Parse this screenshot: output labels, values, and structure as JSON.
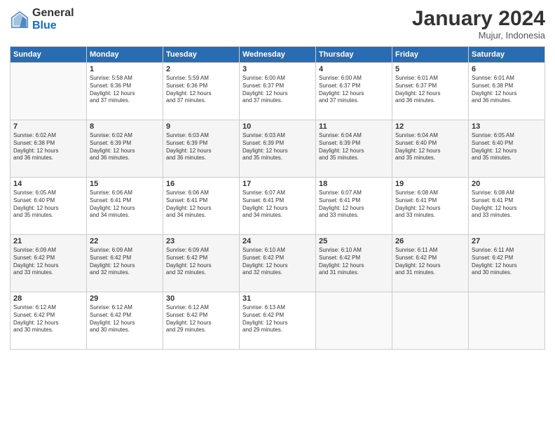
{
  "logo": {
    "general": "General",
    "blue": "Blue"
  },
  "title": "January 2024",
  "subtitle": "Mujur, Indonesia",
  "days_header": [
    "Sunday",
    "Monday",
    "Tuesday",
    "Wednesday",
    "Thursday",
    "Friday",
    "Saturday"
  ],
  "weeks": [
    [
      {
        "day": "",
        "info": ""
      },
      {
        "day": "1",
        "info": "Sunrise: 5:58 AM\nSunset: 6:36 PM\nDaylight: 12 hours\nand 37 minutes."
      },
      {
        "day": "2",
        "info": "Sunrise: 5:59 AM\nSunset: 6:36 PM\nDaylight: 12 hours\nand 37 minutes."
      },
      {
        "day": "3",
        "info": "Sunrise: 6:00 AM\nSunset: 6:37 PM\nDaylight: 12 hours\nand 37 minutes."
      },
      {
        "day": "4",
        "info": "Sunrise: 6:00 AM\nSunset: 6:37 PM\nDaylight: 12 hours\nand 37 minutes."
      },
      {
        "day": "5",
        "info": "Sunrise: 6:01 AM\nSunset: 6:37 PM\nDaylight: 12 hours\nand 36 minutes."
      },
      {
        "day": "6",
        "info": "Sunrise: 6:01 AM\nSunset: 6:38 PM\nDaylight: 12 hours\nand 36 minutes."
      }
    ],
    [
      {
        "day": "7",
        "info": "Sunrise: 6:02 AM\nSunset: 6:38 PM\nDaylight: 12 hours\nand 36 minutes."
      },
      {
        "day": "8",
        "info": "Sunrise: 6:02 AM\nSunset: 6:39 PM\nDaylight: 12 hours\nand 36 minutes."
      },
      {
        "day": "9",
        "info": "Sunrise: 6:03 AM\nSunset: 6:39 PM\nDaylight: 12 hours\nand 36 minutes."
      },
      {
        "day": "10",
        "info": "Sunrise: 6:03 AM\nSunset: 6:39 PM\nDaylight: 12 hours\nand 35 minutes."
      },
      {
        "day": "11",
        "info": "Sunrise: 6:04 AM\nSunset: 6:39 PM\nDaylight: 12 hours\nand 35 minutes."
      },
      {
        "day": "12",
        "info": "Sunrise: 6:04 AM\nSunset: 6:40 PM\nDaylight: 12 hours\nand 35 minutes."
      },
      {
        "day": "13",
        "info": "Sunrise: 6:05 AM\nSunset: 6:40 PM\nDaylight: 12 hours\nand 35 minutes."
      }
    ],
    [
      {
        "day": "14",
        "info": "Sunrise: 6:05 AM\nSunset: 6:40 PM\nDaylight: 12 hours\nand 35 minutes."
      },
      {
        "day": "15",
        "info": "Sunrise: 6:06 AM\nSunset: 6:41 PM\nDaylight: 12 hours\nand 34 minutes."
      },
      {
        "day": "16",
        "info": "Sunrise: 6:06 AM\nSunset: 6:41 PM\nDaylight: 12 hours\nand 34 minutes."
      },
      {
        "day": "17",
        "info": "Sunrise: 6:07 AM\nSunset: 6:41 PM\nDaylight: 12 hours\nand 34 minutes."
      },
      {
        "day": "18",
        "info": "Sunrise: 6:07 AM\nSunset: 6:41 PM\nDaylight: 12 hours\nand 33 minutes."
      },
      {
        "day": "19",
        "info": "Sunrise: 6:08 AM\nSunset: 6:41 PM\nDaylight: 12 hours\nand 33 minutes."
      },
      {
        "day": "20",
        "info": "Sunrise: 6:08 AM\nSunset: 6:41 PM\nDaylight: 12 hours\nand 33 minutes."
      }
    ],
    [
      {
        "day": "21",
        "info": "Sunrise: 6:09 AM\nSunset: 6:42 PM\nDaylight: 12 hours\nand 33 minutes."
      },
      {
        "day": "22",
        "info": "Sunrise: 6:09 AM\nSunset: 6:42 PM\nDaylight: 12 hours\nand 32 minutes."
      },
      {
        "day": "23",
        "info": "Sunrise: 6:09 AM\nSunset: 6:42 PM\nDaylight: 12 hours\nand 32 minutes."
      },
      {
        "day": "24",
        "info": "Sunrise: 6:10 AM\nSunset: 6:42 PM\nDaylight: 12 hours\nand 32 minutes."
      },
      {
        "day": "25",
        "info": "Sunrise: 6:10 AM\nSunset: 6:42 PM\nDaylight: 12 hours\nand 31 minutes."
      },
      {
        "day": "26",
        "info": "Sunrise: 6:11 AM\nSunset: 6:42 PM\nDaylight: 12 hours\nand 31 minutes."
      },
      {
        "day": "27",
        "info": "Sunrise: 6:11 AM\nSunset: 6:42 PM\nDaylight: 12 hours\nand 30 minutes."
      }
    ],
    [
      {
        "day": "28",
        "info": "Sunrise: 6:12 AM\nSunset: 6:42 PM\nDaylight: 12 hours\nand 30 minutes."
      },
      {
        "day": "29",
        "info": "Sunrise: 6:12 AM\nSunset: 6:42 PM\nDaylight: 12 hours\nand 30 minutes."
      },
      {
        "day": "30",
        "info": "Sunrise: 6:12 AM\nSunset: 6:42 PM\nDaylight: 12 hours\nand 29 minutes."
      },
      {
        "day": "31",
        "info": "Sunrise: 6:13 AM\nSunset: 6:42 PM\nDaylight: 12 hours\nand 29 minutes."
      },
      {
        "day": "",
        "info": ""
      },
      {
        "day": "",
        "info": ""
      },
      {
        "day": "",
        "info": ""
      }
    ]
  ]
}
